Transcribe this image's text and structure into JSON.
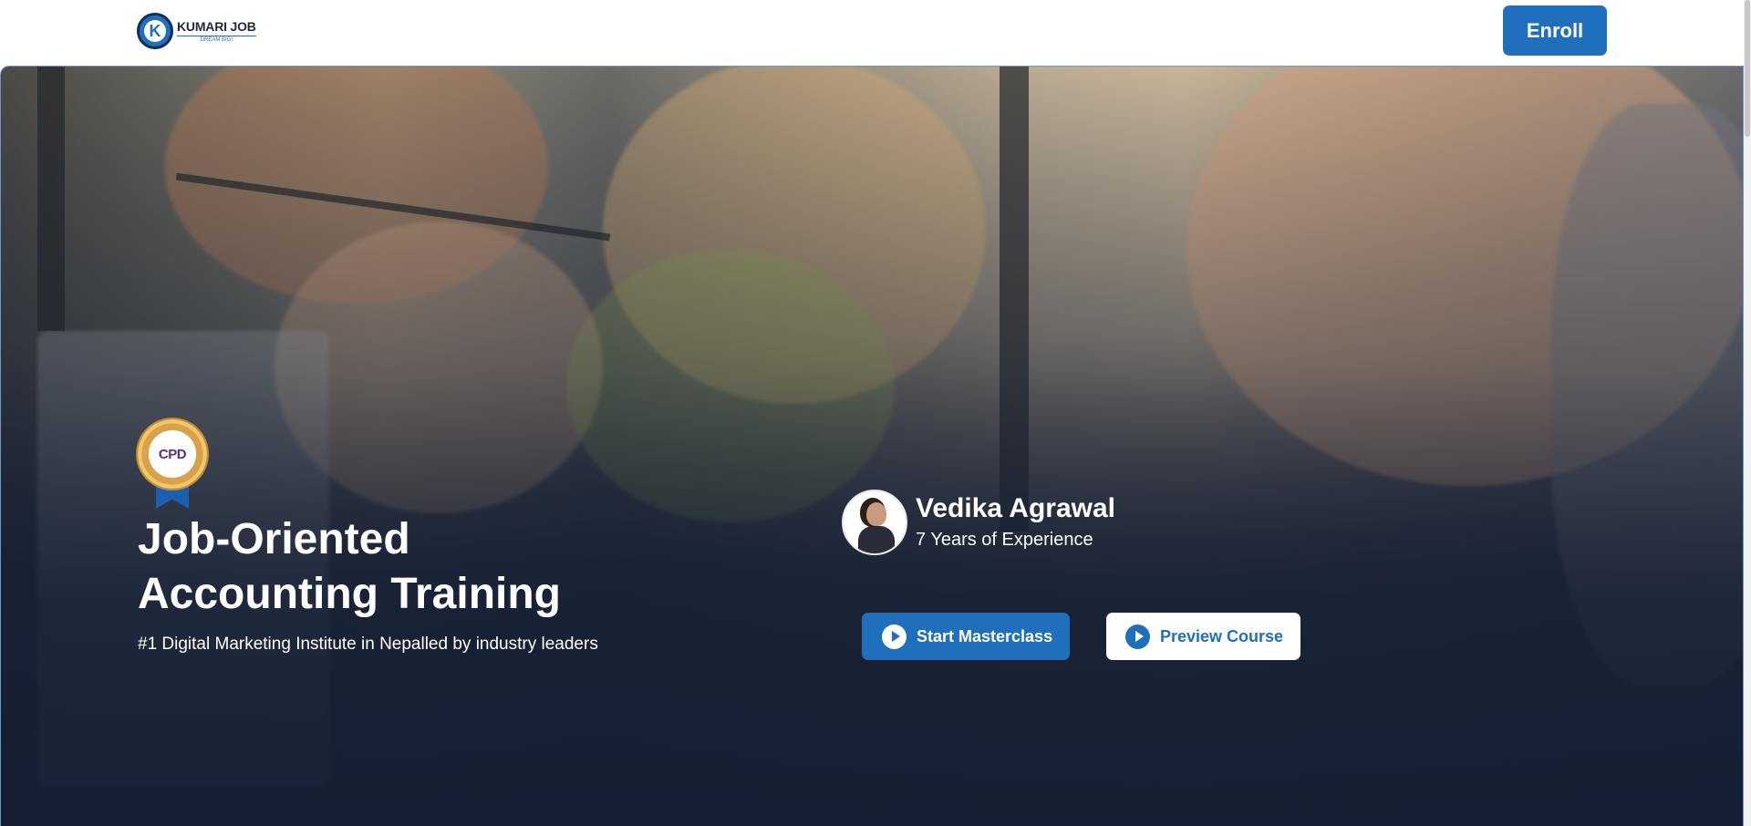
{
  "navbar": {
    "logo_name": "KUMARI JOB",
    "logo_tagline": "DREAM BIG!",
    "logo_letter": "K",
    "enroll_label": "Enroll"
  },
  "hero": {
    "badge_text": "CPD",
    "headline_line1": "Job-Oriented",
    "headline_line2": "Accounting Training",
    "subheadline": "#1 Digital Marketing Institute in Nepalled by industry leaders",
    "instructor": {
      "name": "Vedika Agrawal",
      "experience": "7 Years of Experience"
    },
    "start_button_label": "Start Masterclass",
    "preview_button_label": "Preview Course"
  },
  "colors": {
    "accent": "#1f6fbd",
    "hero_overlay": "#161f33",
    "text_on_dark": "#ffffff"
  },
  "icons": {
    "logo": "k-circle-logo-icon",
    "badge": "cpd-member-badge-icon",
    "start": "play-circle-icon",
    "preview": "play-circle-icon"
  }
}
